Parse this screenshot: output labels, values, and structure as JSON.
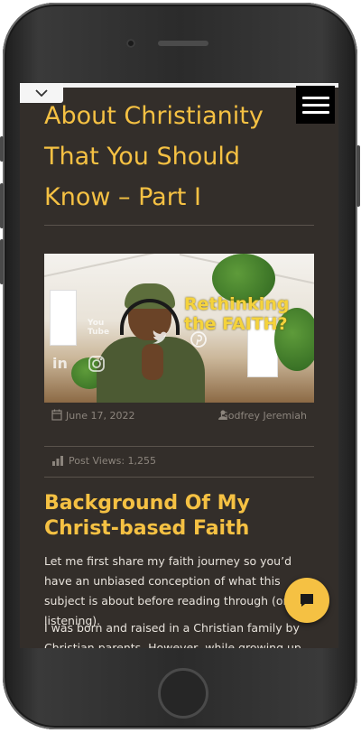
{
  "article": {
    "title": "About Christianity That You Should Know – Part I",
    "hero_overlay": "Rethinking the FAITH?",
    "date": "June 17, 2022",
    "author": "Godfrey Jeremiah",
    "views": "Post Views: 1,255",
    "section_heading": "Background Of My Christ-based Faith",
    "paragraph1": "Let me first share my faith journey so you’d have an unbiased conception of what this subject is about before reading through (or listening).",
    "paragraph2": "I was born and raised in a Christian family by Christian parents. However, while growing up, my"
  },
  "social_icons": [
    "email-icon",
    "youtube-icon",
    "twitter-icon",
    "pinterest-icon",
    "linkedin-icon",
    "instagram-icon"
  ],
  "social_labels": {
    "you": "You",
    "tube": "Tube",
    "linkedin": "in"
  },
  "colors": {
    "accent": "#f5c143",
    "background": "#332e2a",
    "text": "#e8e3dc",
    "meta": "#8c857d"
  }
}
